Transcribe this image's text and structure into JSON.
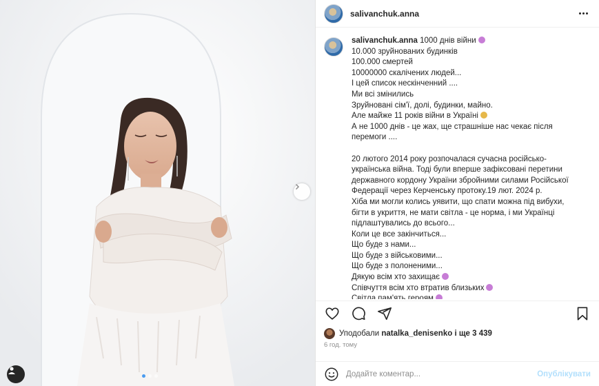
{
  "post": {
    "username": "salivanchuk.anna",
    "caption_lines": [
      {
        "text": "1000 днів війни",
        "emoji": "#c77dd6"
      },
      {
        "text": "10.000 зруйнованих будинків"
      },
      {
        "text": "100.000 смертей"
      },
      {
        "text": "10000000 скалічених людей..."
      },
      {
        "text": "І цей список нескінченний ...."
      },
      {
        "text": "Ми всі змінились"
      },
      {
        "text": "Зруйновані сім'ї, долі, будинки, майно."
      },
      {
        "text": "Але майже 11 років війни в Україні",
        "emoji": "#e6b84a"
      },
      {
        "text": "А не 1000 днів - це жах, ще страшніше нас чекає після"
      },
      {
        "text": "перемоги ...."
      },
      {
        "text": ""
      },
      {
        "text": "20 лютого 2014 року розпочалася сучасна російсько-"
      },
      {
        "text": "українська війна. Тоді були вперше зафіксовані перетини"
      },
      {
        "text": "державного кордону України збройними силами Російської"
      },
      {
        "text": "Федерації через Керченську протоку.19 лют. 2024 р."
      },
      {
        "text": "Хіба ми могли колись уявити, що спати можна під вибухи,"
      },
      {
        "text": "бігти в укриття, не мати світла - це норма, і ми Українці"
      },
      {
        "text": "підлаштувались до всього..."
      },
      {
        "text": "Коли це все закінчиться..."
      },
      {
        "text": "Що буде з нами..."
      },
      {
        "text": "Що буде з військовими..."
      },
      {
        "text": "Що буде з полоненими..."
      },
      {
        "text": "Дякую всім хто захищає",
        "emoji": "#c77dd6"
      },
      {
        "text": "Співчуття всім хто втратив близьких",
        "emoji": "#c77dd6"
      },
      {
        "text": "Світла пам'ять героям",
        "emoji": "#c77dd6"
      }
    ]
  },
  "likes": {
    "prefix": "Уподобали",
    "user": "natalka_denisenko",
    "suffix": "і ще 3 439"
  },
  "time_ago": "6 год. тому",
  "comment": {
    "placeholder": "Додайте коментар...",
    "post_label": "Опублікувати"
  },
  "icons": {
    "more": "more-options-icon",
    "like": "heart-icon",
    "comment": "comment-icon",
    "share": "share-icon",
    "save": "bookmark-icon",
    "emoji": "emoji-icon",
    "next": "chevron-right-icon"
  },
  "colors": {
    "text": "#262626",
    "muted": "#8e8e8e",
    "post_button": "#b2dffc",
    "active_dot": "#4a9cf0"
  }
}
